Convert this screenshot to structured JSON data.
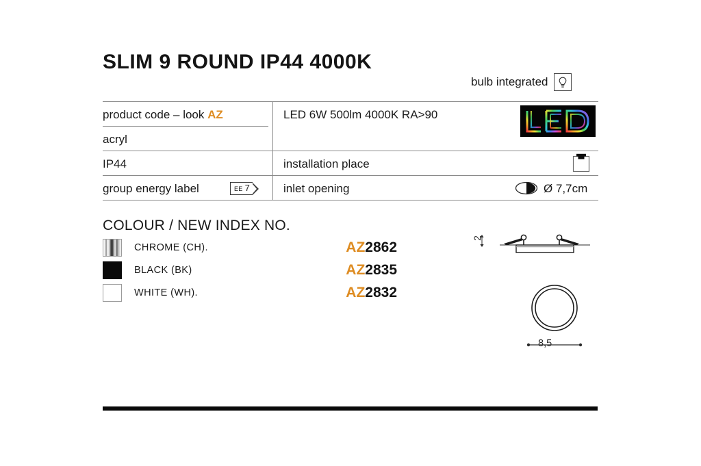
{
  "page": {
    "title": "SLIM 9 ROUND IP44 4000K",
    "accent_color": "#DE8C22",
    "rule_color": "#0A0A0A"
  },
  "bulb": {
    "label": "bulb integrated",
    "icon": "bulb-icon"
  },
  "spec_table": {
    "left_rows": [
      {
        "text_before": "product code – look ",
        "accent": "AZ"
      },
      {
        "text_before": "acryl",
        "accent": ""
      },
      {
        "text_before": "IP44",
        "accent": ""
      },
      {
        "text_before": "group energy label",
        "accent": ""
      }
    ],
    "energy_label": {
      "prefix": "EE",
      "value": "7"
    },
    "right_rows": [
      {
        "label": "LED 6W 500lm 4000K RA>90",
        "icon": "led-logo",
        "value": ""
      },
      {
        "label": "installation place",
        "icon": "ceiling-recess-icon",
        "value": ""
      },
      {
        "label": "inlet opening",
        "icon": "cut-hole-icon",
        "value": "Ø 7,7cm"
      }
    ],
    "led_logo_text": "LED"
  },
  "colour_section": {
    "heading": "COLOUR / NEW INDEX NO.",
    "rows": [
      {
        "swatch": "chrome",
        "name": "CHROME (CH).",
        "code_prefix": "AZ",
        "code_number": "2862"
      },
      {
        "swatch": "black",
        "name": "BLACK (BK)",
        "code_prefix": "AZ",
        "code_number": "2835"
      },
      {
        "swatch": "white",
        "name": "WHITE (WH).",
        "code_prefix": "AZ",
        "code_number": "2832"
      }
    ]
  },
  "drawings": {
    "side_view": {
      "name": "recessed-downlight-side-view",
      "dimension": "2"
    },
    "plan_view": {
      "name": "round-fixture-plan-view",
      "dimension": "8,5"
    }
  }
}
